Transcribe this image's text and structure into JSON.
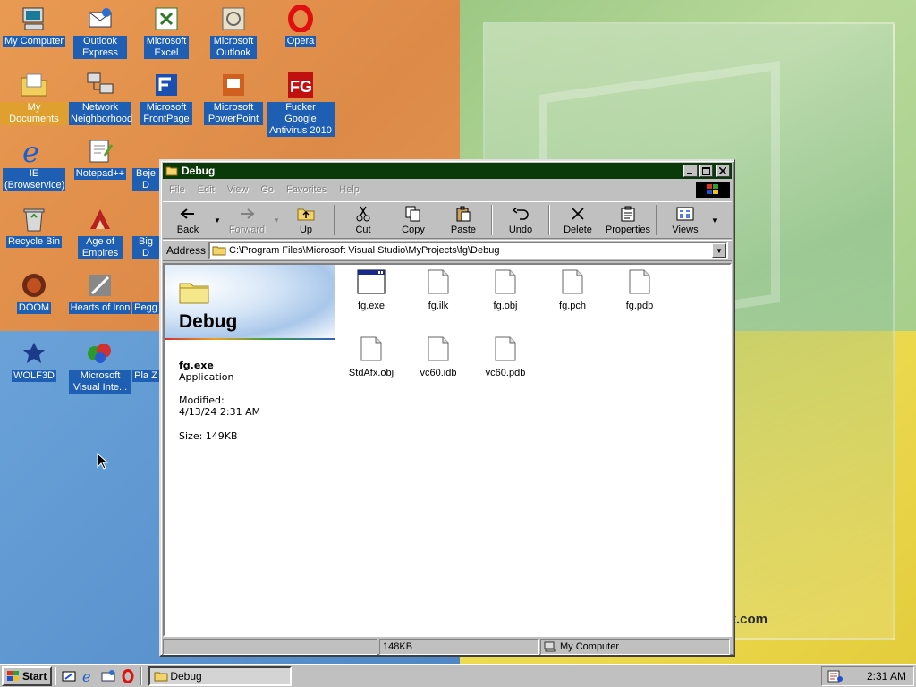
{
  "desktop": {
    "brand_text": "t.com",
    "icons": [
      {
        "label": "My Computer",
        "icon": "my-computer-icon"
      },
      {
        "label": "Outlook Express",
        "icon": "outlook-express-icon"
      },
      {
        "label": "Microsoft Excel",
        "icon": "excel-icon"
      },
      {
        "label": "Microsoft Outlook",
        "icon": "outlook-icon"
      },
      {
        "label": "Opera",
        "icon": "opera-icon"
      },
      {
        "label": "My Documents",
        "icon": "my-documents-icon"
      },
      {
        "label": "Network Neighborhood",
        "icon": "network-neighborhood-icon"
      },
      {
        "label": "Microsoft FrontPage",
        "icon": "frontpage-icon"
      },
      {
        "label": "Microsoft PowerPoint",
        "icon": "powerpoint-icon"
      },
      {
        "label": "Fucker Google Antivirus 2010",
        "icon": "fg-antivirus-icon"
      },
      {
        "label": "IE (Browservice)",
        "icon": "internet-explorer-icon"
      },
      {
        "label": "Notepad++",
        "icon": "notepad-plus-plus-icon"
      },
      {
        "label": "Beje D",
        "icon": "bejeweled-icon"
      },
      {
        "label": "Recycle Bin",
        "icon": "recycle-bin-icon"
      },
      {
        "label": "Age of Empires",
        "icon": "age-of-empires-icon"
      },
      {
        "label": "Big D",
        "icon": "game-icon"
      },
      {
        "label": "DOOM",
        "icon": "doom-icon"
      },
      {
        "label": "Hearts of Iron",
        "icon": "hearts-of-iron-icon"
      },
      {
        "label": "Pegg",
        "icon": "peggle-icon"
      },
      {
        "label": "WOLF3D",
        "icon": "wolf3d-icon"
      },
      {
        "label": "Microsoft Visual Inte...",
        "icon": "visual-interdev-icon"
      },
      {
        "label": "Pla Z",
        "icon": "game-icon"
      }
    ]
  },
  "window": {
    "title": "Debug",
    "menu": [
      {
        "label": "File",
        "key": "F"
      },
      {
        "label": "Edit",
        "key": "E"
      },
      {
        "label": "View",
        "key": "V"
      },
      {
        "label": "Go",
        "key": "G"
      },
      {
        "label": "Favorites",
        "key": "a"
      },
      {
        "label": "Help",
        "key": "H"
      }
    ],
    "toolbar": {
      "back": "Back",
      "forward": "Forward",
      "up": "Up",
      "cut": "Cut",
      "copy": "Copy",
      "paste": "Paste",
      "undo": "Undo",
      "delete": "Delete",
      "properties": "Properties",
      "views": "Views"
    },
    "address": {
      "label": "Address",
      "path": "C:\\Program Files\\Microsoft Visual Studio\\MyProjects\\fg\\Debug"
    },
    "info_pane": {
      "folder_name": "Debug",
      "selected_name": "fg.exe",
      "selected_type": "Application",
      "modified_label": "Modified:",
      "modified_value": "4/13/24 2:31 AM",
      "size_text": "Size: 149KB"
    },
    "files": [
      {
        "name": "fg.exe",
        "kind": "application"
      },
      {
        "name": "fg.ilk",
        "kind": "document"
      },
      {
        "name": "fg.obj",
        "kind": "document"
      },
      {
        "name": "fg.pch",
        "kind": "document"
      },
      {
        "name": "fg.pdb",
        "kind": "document"
      },
      {
        "name": "StdAfx.obj",
        "kind": "document"
      },
      {
        "name": "vc60.idb",
        "kind": "document"
      },
      {
        "name": "vc60.pdb",
        "kind": "document"
      }
    ],
    "status": {
      "cell1": "",
      "size": "148KB",
      "location": "My Computer"
    }
  },
  "taskbar": {
    "start_label": "Start",
    "task_label": "Debug",
    "clock": "2:31 AM"
  },
  "colors": {
    "title_bar": "#0a3a0a",
    "icon_label_bg": "#1f5fb3",
    "selected_label_bg": "#e0a030"
  }
}
